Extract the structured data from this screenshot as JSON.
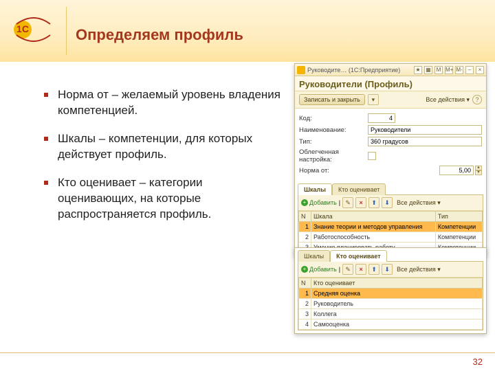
{
  "slide": {
    "title": "Определяем профиль",
    "page_number": "32",
    "bullets": [
      "Норма от – желаемый уровень владения компетенцией.",
      "Шкалы – компетенции, для которых действует профиль.",
      "Кто оценивает – категории оценивающих, на которые распространяется профиль."
    ]
  },
  "window": {
    "titlebar": "Руководите… (1С:Предприятие)",
    "tb_buttons": [
      "M",
      "M+",
      "M-"
    ],
    "form_title": "Руководители (Профиль)",
    "save_label": "Записать и закрыть",
    "all_actions": "Все действия ▾",
    "fields": {
      "code_label": "Код:",
      "code_value": "4",
      "name_label": "Наименование:",
      "name_value": "Руководители",
      "type_label": "Тип:",
      "type_value": "360 градусов",
      "light_label": "Облегченная настройка:",
      "norm_label": "Норма от:",
      "norm_value": "5,00"
    },
    "tabs": {
      "scales": "Шкалы",
      "raters": "Кто оценивает"
    },
    "grid_toolbar": {
      "add": "Добавить"
    },
    "scales_grid": {
      "cols": {
        "n": "N",
        "scale": "Шкала",
        "type": "Тип"
      },
      "rows": [
        {
          "n": "1",
          "scale": "Знание теории и методов управления",
          "type": "Компетенции"
        },
        {
          "n": "2",
          "scale": "Работоспособность",
          "type": "Компетенции"
        },
        {
          "n": "3",
          "scale": "Умение планировать работу",
          "type": "Компетенции"
        }
      ]
    },
    "raters_grid": {
      "cols": {
        "n": "N",
        "who": "Кто оценивает"
      },
      "rows": [
        {
          "n": "1",
          "who": "Средняя оценка"
        },
        {
          "n": "2",
          "who": "Руководитель"
        },
        {
          "n": "3",
          "who": "Коллега"
        },
        {
          "n": "4",
          "who": "Самооценка"
        }
      ]
    }
  }
}
